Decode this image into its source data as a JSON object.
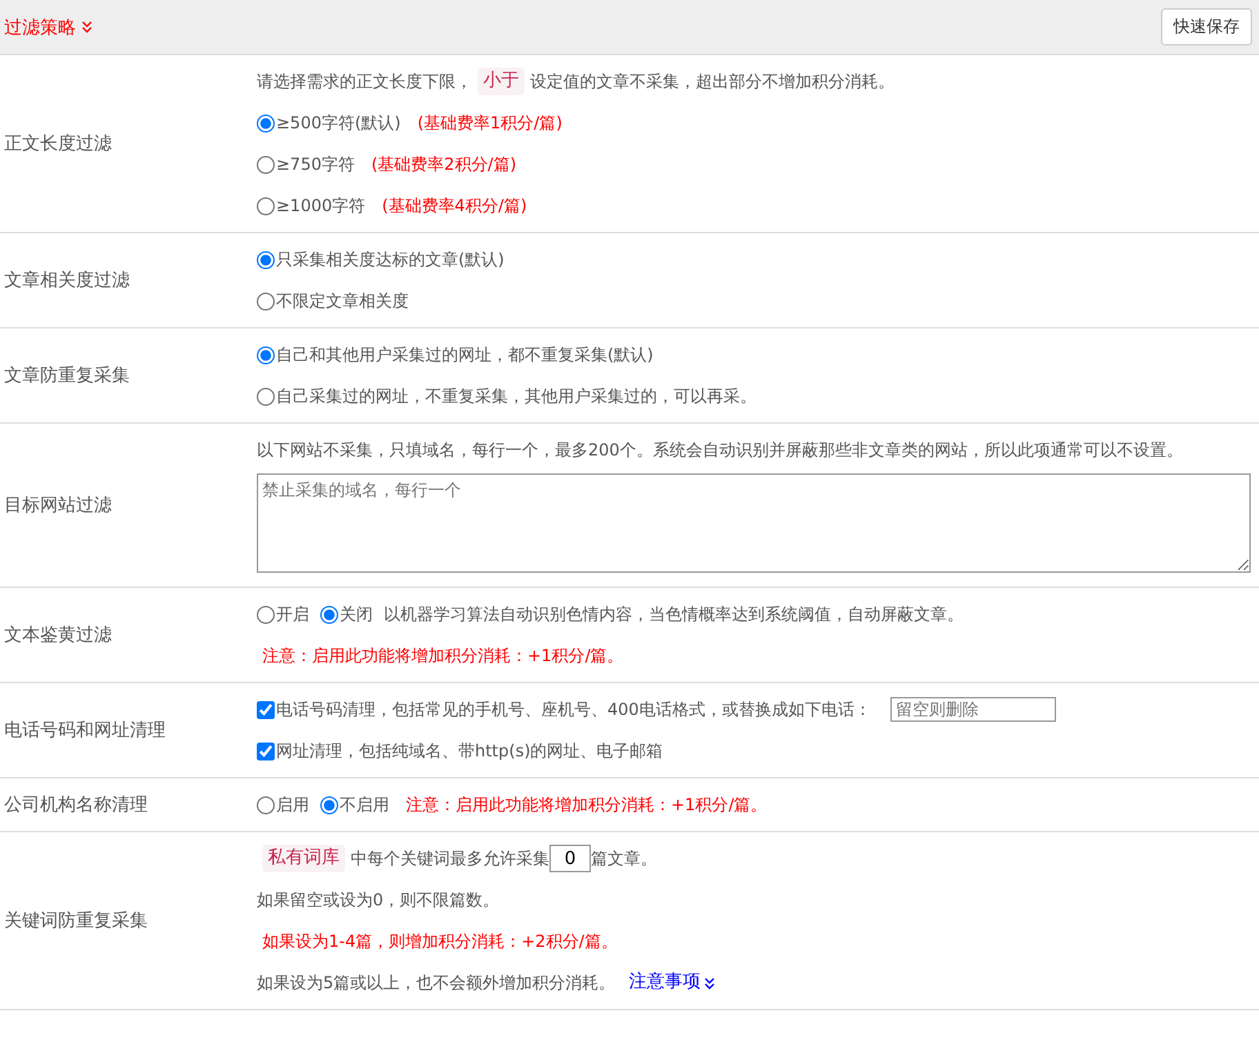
{
  "header": {
    "title": "过滤策略",
    "save_button": "快速保存"
  },
  "rows": [
    {
      "label": "正文长度过滤",
      "lines": [
        [
          {
            "kind": "text",
            "text": "请选择需求的正文长度下限，"
          },
          {
            "kind": "tag",
            "text": "小于"
          },
          {
            "kind": "text",
            "text": "设定值的文章不采集，超出部分不增加积分消耗。"
          }
        ],
        [
          {
            "kind": "radio",
            "text": "≥500字符(默认)",
            "selected": true
          },
          {
            "kind": "note",
            "text": "(基础费率1积分/篇)"
          }
        ],
        [
          {
            "kind": "radio",
            "text": "≥750字符",
            "selected": false
          },
          {
            "kind": "note",
            "text": "(基础费率2积分/篇)"
          }
        ],
        [
          {
            "kind": "radio",
            "text": "≥1000字符",
            "selected": false
          },
          {
            "kind": "note",
            "text": "(基础费率4积分/篇)"
          }
        ]
      ]
    },
    {
      "label": "文章相关度过滤",
      "lines": [
        [
          {
            "kind": "radio",
            "text": "只采集相关度达标的文章(默认)",
            "selected": true
          }
        ],
        [
          {
            "kind": "radio",
            "text": "不限定文章相关度",
            "selected": false
          }
        ]
      ]
    },
    {
      "label": "文章防重复采集",
      "lines": [
        [
          {
            "kind": "radio",
            "text": "自己和其他用户采集过的网址，都不重复采集(默认)",
            "selected": true
          }
        ],
        [
          {
            "kind": "radio",
            "text": "自己采集过的网址，不重复采集，其他用户采集过的，可以再采。",
            "selected": false
          }
        ]
      ]
    },
    {
      "label": "目标网站过滤",
      "lines": [
        [
          {
            "kind": "text",
            "text": "以下网站不采集，只填域名，每行一个，最多200个。系统会自动识别并屏蔽那些非文章类的网站，所以此项通常可以不设置。"
          }
        ],
        [
          {
            "kind": "textarea",
            "placeholder": "禁止采集的域名，每行一个"
          }
        ]
      ]
    },
    {
      "label": "文本鉴黄过滤",
      "lines": [
        [
          {
            "kind": "radio",
            "text": "开启",
            "selected": false
          },
          {
            "kind": "radio",
            "text": "关闭",
            "selected": true
          },
          {
            "kind": "text",
            "text": "以机器学习算法自动识别色情内容，当色情概率达到系统阈值，自动屏蔽文章。"
          }
        ],
        [
          {
            "kind": "note",
            "text": "注意：启用此功能将增加积分消耗：+1积分/篇。"
          }
        ]
      ]
    },
    {
      "label": "电话号码和网址清理",
      "lines": [
        [
          {
            "kind": "checkbox",
            "text": "电话号码清理，包括常见的手机号、座机号、400电话格式，或替换成如下电话：",
            "checked": true
          },
          {
            "kind": "input",
            "placeholder": "留空则删除"
          }
        ],
        [
          {
            "kind": "checkbox",
            "text": "网址清理，包括纯域名、带http(s)的网址、电子邮箱",
            "checked": true
          }
        ]
      ]
    },
    {
      "label": "公司机构名称清理",
      "lines": [
        [
          {
            "kind": "radio",
            "text": "启用",
            "selected": false
          },
          {
            "kind": "radio",
            "text": "不启用",
            "selected": true
          },
          {
            "kind": "note",
            "text": "注意：启用此功能将增加积分消耗：+1积分/篇。"
          }
        ]
      ]
    },
    {
      "label": "关键词防重复采集",
      "lines": [
        [
          {
            "kind": "tag",
            "text": "私有词库"
          },
          {
            "kind": "text",
            "text": "中每个关键词最多允许采集"
          },
          {
            "kind": "number",
            "value": "0"
          },
          {
            "kind": "text",
            "text": "篇文章。"
          }
        ],
        [
          {
            "kind": "text",
            "text": "如果留空或设为0，则不限篇数。"
          }
        ],
        [
          {
            "kind": "note",
            "text": "如果设为1-4篇，则增加积分消耗：+2积分/篇。"
          }
        ],
        [
          {
            "kind": "text",
            "text": "如果设为5篇或以上，也不会额外增加积分消耗。"
          },
          {
            "kind": "link",
            "text": "注意事项"
          }
        ]
      ]
    }
  ]
}
